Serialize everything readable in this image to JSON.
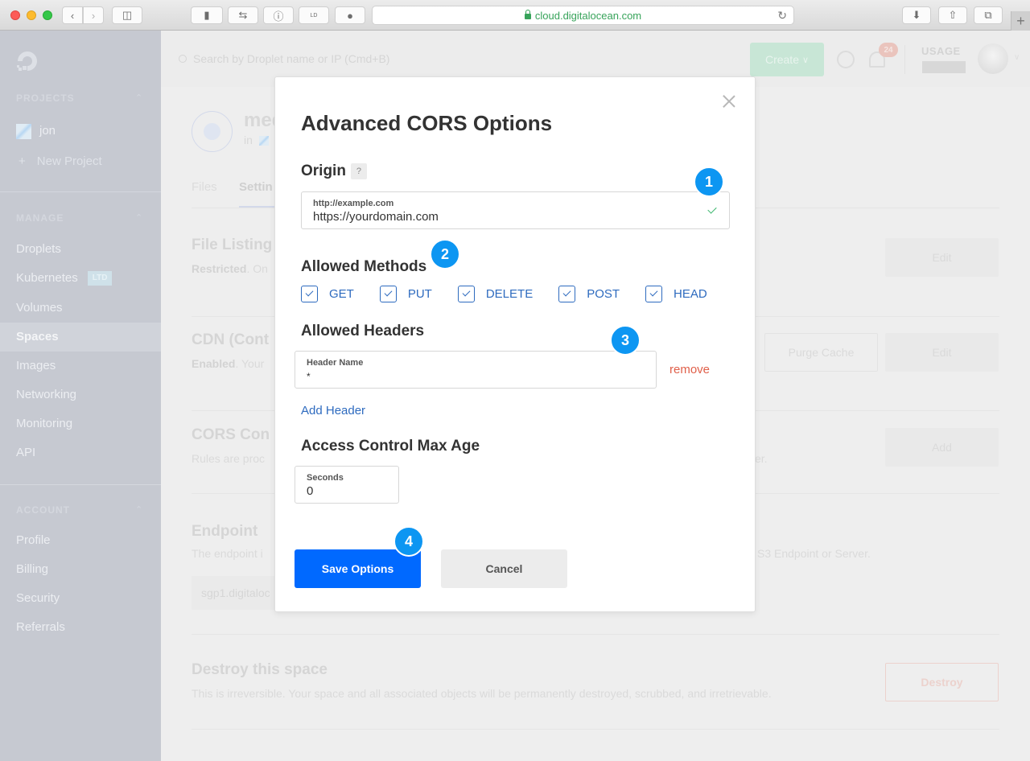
{
  "browser": {
    "url": "cloud.digitalocean.com",
    "toolbar_icons": [
      "back-icon",
      "forward-icon",
      "sidebar-icon",
      "extension-icon",
      "sync-icon",
      "password-icon",
      "ld-icon",
      "js-icon",
      "download-icon",
      "share-icon",
      "tabs-icon",
      "new-tab-icon"
    ],
    "ld_label": "LD"
  },
  "sidebar": {
    "projects_title": "PROJECTS",
    "projects": [
      {
        "label": "jon"
      }
    ],
    "new_project": "New Project",
    "manage_title": "MANAGE",
    "manage_items": [
      {
        "label": "Droplets"
      },
      {
        "label": "Kubernetes",
        "badge": "LTD"
      },
      {
        "label": "Volumes"
      },
      {
        "label": "Spaces",
        "active": true
      },
      {
        "label": "Images"
      },
      {
        "label": "Networking"
      },
      {
        "label": "Monitoring"
      },
      {
        "label": "API"
      }
    ],
    "account_title": "ACCOUNT",
    "account_items": [
      {
        "label": "Profile"
      },
      {
        "label": "Billing"
      },
      {
        "label": "Security"
      },
      {
        "label": "Referrals"
      }
    ]
  },
  "topbar": {
    "search_placeholder": "Search by Droplet name or IP (Cmd+B)",
    "create_label": "Create",
    "notification_count": "24",
    "usage_label": "USAGE"
  },
  "page": {
    "space_name": "med",
    "space_in": "in",
    "tabs": [
      {
        "label": "Files"
      },
      {
        "label": "Settin"
      }
    ],
    "sections": {
      "file_listing": {
        "title": "File Listing",
        "status": "Restricted",
        "text": ". On"
      },
      "cdn": {
        "title": "CDN (Cont",
        "status": "Enabled",
        "text": ". Your"
      },
      "cors": {
        "title": "CORS Con",
        "text": "Rules are proc",
        "text_end": "er."
      },
      "endpoint": {
        "title": "Endpoint",
        "text": "The endpoint i",
        "text_end": "S3 Endpoint or Server.",
        "value": "sgp1.digitaloc"
      },
      "destroy": {
        "title": "Destroy this space",
        "text": "This is irreversible. Your space and all associated objects will be permanently destroyed, scrubbed, and irretrievable."
      }
    },
    "buttons": {
      "edit": "Edit",
      "purge_cache": "Purge Cache",
      "add": "Add",
      "destroy": "Destroy"
    }
  },
  "modal": {
    "title": "Advanced CORS Options",
    "origin": {
      "heading": "Origin",
      "help": "?",
      "field_label": "http://example.com",
      "value": "https://yourdomain.com",
      "valid": true
    },
    "methods": {
      "heading": "Allowed Methods",
      "items": [
        {
          "label": "GET",
          "checked": true
        },
        {
          "label": "PUT",
          "checked": true
        },
        {
          "label": "DELETE",
          "checked": true
        },
        {
          "label": "POST",
          "checked": true
        },
        {
          "label": "HEAD",
          "checked": true
        }
      ]
    },
    "headers": {
      "heading": "Allowed Headers",
      "field_label": "Header Name",
      "value": "*",
      "remove_label": "remove",
      "add_label": "Add Header"
    },
    "max_age": {
      "heading": "Access Control Max Age",
      "field_label": "Seconds",
      "value": "0"
    },
    "save_label": "Save Options",
    "cancel_label": "Cancel"
  },
  "markers": [
    "1",
    "2",
    "3",
    "4"
  ],
  "colors": {
    "primary": "#0069ff",
    "link": "#2e6bbf",
    "danger": "#e0604a",
    "success": "#37b56a",
    "marker": "#0d96f2"
  }
}
